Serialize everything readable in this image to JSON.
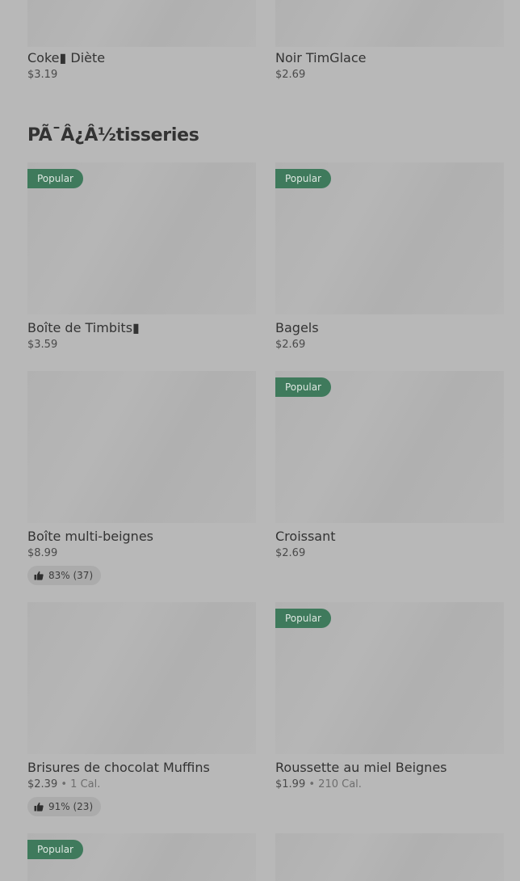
{
  "top_row": [
    {
      "name": "Coke▮ Diète",
      "price": "$3.19"
    },
    {
      "name": "Noir TimGlace",
      "price": "$2.69"
    }
  ],
  "section_title": "PÃ¯Â¿Â½tisseries",
  "items": [
    {
      "name": "Boîte de Timbits▮",
      "price": "$3.59",
      "badge": "Popular"
    },
    {
      "name": "Bagels",
      "price": "$2.69",
      "badge": "Popular"
    },
    {
      "name": "Boîte multi-beignes",
      "price": "$8.99",
      "rating": "83% (37)"
    },
    {
      "name": "Croissant",
      "price": "$2.69",
      "badge": "Popular"
    },
    {
      "name": "Brisures de chocolat Muffins",
      "price": "$2.39",
      "calories": "1 Cal.",
      "rating": "91% (23)"
    },
    {
      "name": "Roussette au miel Beignes",
      "price": "$1.99",
      "calories": "210 Cal.",
      "badge": "Popular"
    }
  ],
  "bottom_row": [
    {
      "badge": "Popular"
    },
    {}
  ],
  "separator": "•",
  "icons": {
    "rating": "thumbs-up-icon"
  }
}
